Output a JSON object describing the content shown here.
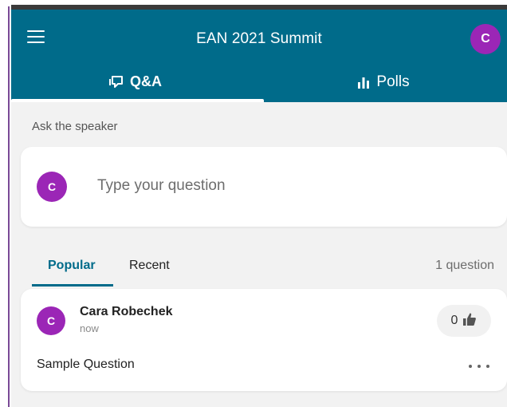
{
  "header": {
    "title": "EAN 2021 Summit",
    "user_initial": "C",
    "tabs": [
      {
        "label": "Q&A",
        "icon": "chat-icon",
        "active": true
      },
      {
        "label": "Polls",
        "icon": "bar-chart-icon",
        "active": false
      }
    ]
  },
  "ask": {
    "label": "Ask the speaker",
    "placeholder": "Type your question",
    "user_initial": "C"
  },
  "sort": {
    "tabs": [
      {
        "label": "Popular",
        "active": true
      },
      {
        "label": "Recent",
        "active": false
      }
    ],
    "count_text": "1 question"
  },
  "questions": [
    {
      "author": "Cara Robechek",
      "initial": "C",
      "time": "now",
      "text": "Sample Question",
      "likes": "0"
    }
  ],
  "colors": {
    "brand": "#006b8a",
    "avatar": "#9b26b6",
    "background": "#f2f2f2"
  }
}
